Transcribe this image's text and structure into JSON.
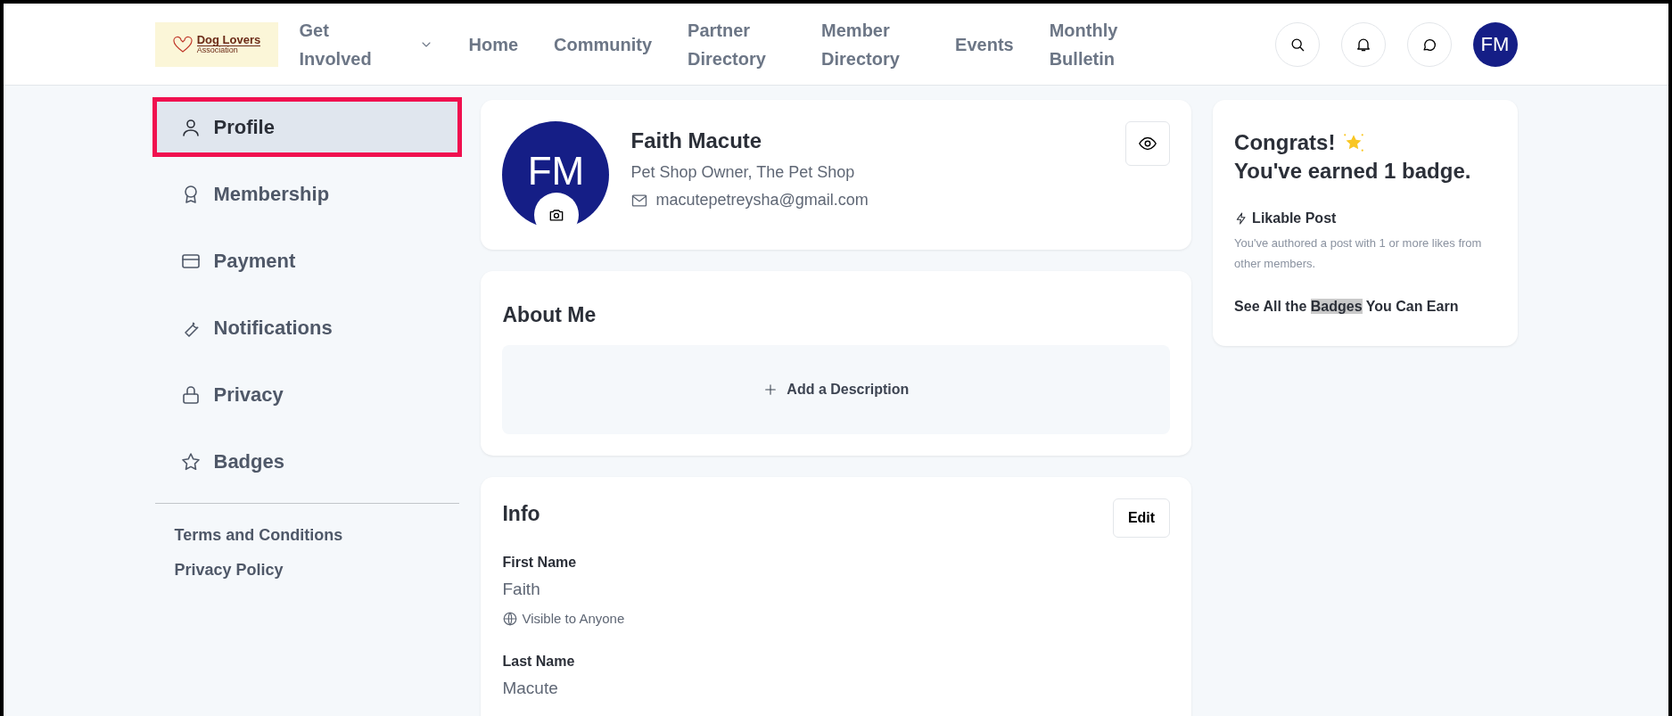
{
  "logo": {
    "title": "Dog Lovers",
    "subtitle": "Association"
  },
  "nav": [
    {
      "label": "Get Involved",
      "has_menu": true
    },
    {
      "label": "Home",
      "has_menu": false
    },
    {
      "label": "Community",
      "has_menu": false
    },
    {
      "label": "Partner Directory",
      "has_menu": false
    },
    {
      "label": "Member Directory",
      "has_menu": false
    },
    {
      "label": "Events",
      "has_menu": false
    },
    {
      "label": "Monthly Bulletin",
      "has_menu": false
    }
  ],
  "header_avatar": {
    "initials": "FM"
  },
  "sidebar": {
    "items": [
      {
        "label": "Profile",
        "selected": true
      },
      {
        "label": "Membership",
        "selected": false
      },
      {
        "label": "Payment",
        "selected": false
      },
      {
        "label": "Notifications",
        "selected": false
      },
      {
        "label": "Privacy",
        "selected": false
      },
      {
        "label": "Badges",
        "selected": false
      }
    ],
    "links": [
      "Terms and Conditions",
      "Privacy Policy"
    ]
  },
  "profile": {
    "initials": "FM",
    "name": "Faith Macute",
    "role": "Pet Shop Owner, The Pet Shop",
    "email": "macutepetreysha@gmail.com"
  },
  "about": {
    "title": "About Me",
    "action": "Add a Description"
  },
  "info": {
    "title": "Info",
    "edit": "Edit",
    "fields": [
      {
        "label": "First Name",
        "value": "Faith",
        "visibility": "Visible to Anyone"
      },
      {
        "label": "Last Name",
        "value": "Macute"
      }
    ]
  },
  "badges_card": {
    "title": "Congrats!",
    "subtitle": "You've earned 1 badge.",
    "badge_name": "Likable Post",
    "badge_text": "You've authored a post with 1 or more likes from other members.",
    "link_before": "See All the ",
    "link_highlight": "Badges",
    "link_after": " You Can Earn"
  }
}
